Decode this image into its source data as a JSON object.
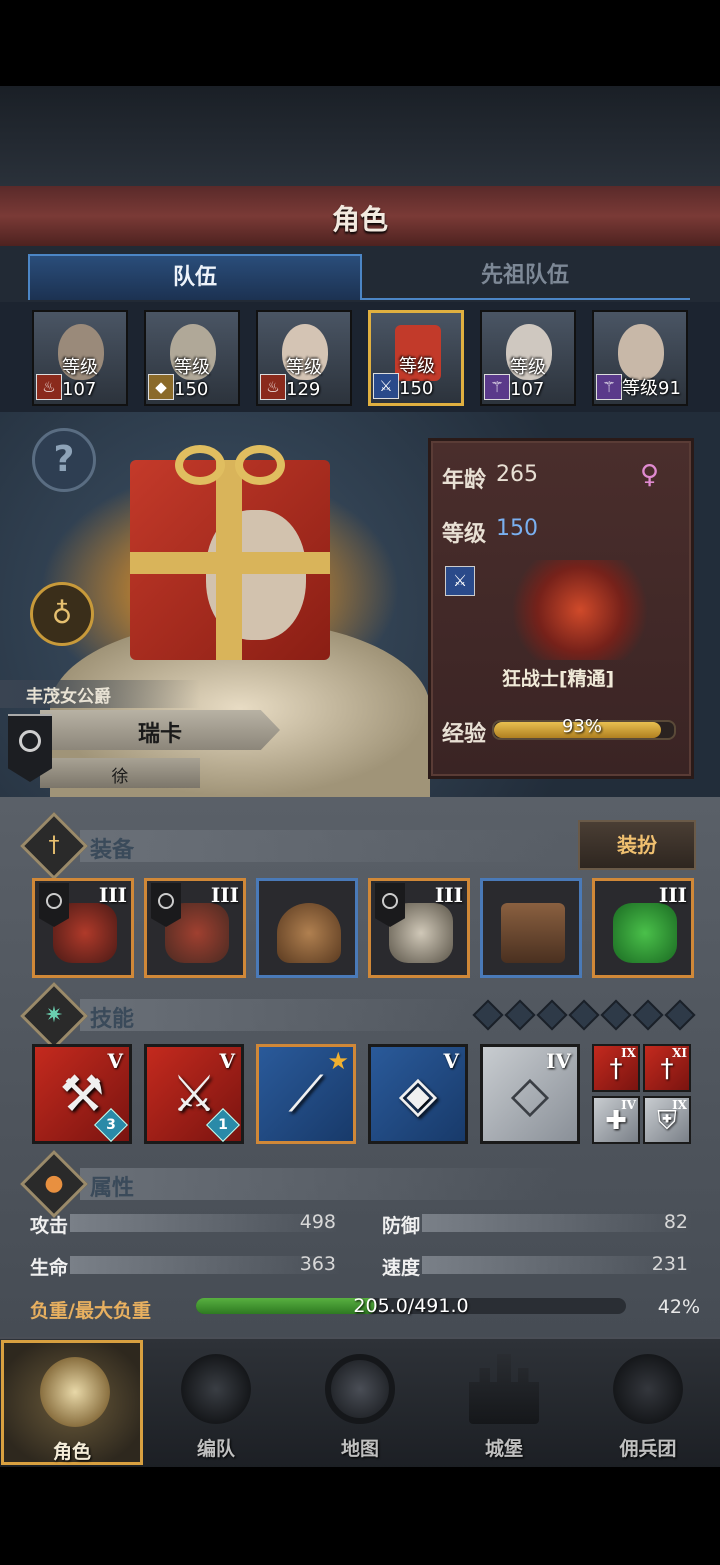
{
  "header": {
    "title": "角色"
  },
  "tabs": [
    {
      "label": "队伍",
      "active": true
    },
    {
      "label": "先祖队伍",
      "active": false
    }
  ],
  "roster": [
    {
      "level_text": "等级107",
      "class_icon": "fire-class-icon",
      "selected": false
    },
    {
      "level_text": "等级150",
      "class_icon": "shield-class-icon",
      "selected": false
    },
    {
      "level_text": "等级129",
      "class_icon": "fire-class-icon",
      "selected": false
    },
    {
      "level_text": "等级150",
      "class_icon": "sword-class-icon",
      "selected": true
    },
    {
      "level_text": "等级107",
      "class_icon": "staff-class-icon",
      "selected": false
    },
    {
      "level_text": "等级91",
      "class_icon": "staff-class-icon",
      "selected": false
    }
  ],
  "character": {
    "title": "丰茂女公爵",
    "name": "瑞卡",
    "subname": "徐"
  },
  "stats_card": {
    "age_label": "年龄",
    "age_value": "265",
    "level_label": "等级",
    "level_value": "150",
    "gender_icon": "female-icon",
    "class_name": "狂战士[精通]",
    "exp_label": "经验",
    "exp_text": "93%",
    "exp_fraction": 0.93
  },
  "equipment": {
    "section_title": "装备",
    "outfit_button": "装扮",
    "slots": [
      {
        "rank": "III",
        "frame": "orange",
        "flag": true,
        "icon": "weapon-icon"
      },
      {
        "rank": "III",
        "frame": "orange",
        "flag": true,
        "icon": "weapon-icon"
      },
      {
        "rank": "",
        "frame": "blue",
        "flag": false,
        "icon": "helmet-icon"
      },
      {
        "rank": "III",
        "frame": "orange",
        "flag": true,
        "icon": "armor-icon"
      },
      {
        "rank": "",
        "frame": "blue",
        "flag": false,
        "icon": "boots-icon"
      },
      {
        "rank": "III",
        "frame": "orange",
        "flag": false,
        "icon": "jade-trinket-icon"
      }
    ]
  },
  "skills": {
    "section_title": "技能",
    "slot_pips": 7,
    "list": [
      {
        "rank": "V",
        "color": "red",
        "count": "3",
        "icon": "axe-strike-icon"
      },
      {
        "rank": "V",
        "color": "red",
        "count": "1",
        "icon": "cleave-icon"
      },
      {
        "rank": "",
        "color": "blue",
        "count": "",
        "icon": "claw-slash-icon",
        "starred": true
      },
      {
        "rank": "V",
        "color": "blue",
        "count": "",
        "icon": "crystal-axe-icon"
      },
      {
        "rank": "IV",
        "color": "grey",
        "count": "",
        "icon": "crystal-shield-icon"
      }
    ],
    "passives": [
      {
        "rank": "IX",
        "color": "red",
        "icon": "sword-passive-icon"
      },
      {
        "rank": "XI",
        "color": "red",
        "icon": "sword-passive-icon"
      },
      {
        "rank": "IV",
        "color": "grey",
        "icon": "heal-cross-icon"
      },
      {
        "rank": "IX",
        "color": "grey",
        "icon": "shield-passive-icon"
      }
    ]
  },
  "attributes": {
    "section_title": "属性",
    "attack_label": "攻击",
    "attack_value": "498",
    "defense_label": "防御",
    "defense_value": "82",
    "hp_label": "生命",
    "hp_value": "363",
    "speed_label": "速度",
    "speed_value": "231",
    "load_label": "负重/最大负重",
    "load_text": "205.0/491.0",
    "load_percent": "42%",
    "load_fraction": 0.42
  },
  "nav": [
    {
      "label": "角色",
      "icon": "knight-icon",
      "selected": true
    },
    {
      "label": "编队",
      "icon": "helmet-squad-icon",
      "selected": false
    },
    {
      "label": "地图",
      "icon": "compass-map-icon",
      "selected": false
    },
    {
      "label": "城堡",
      "icon": "castle-icon",
      "selected": false
    },
    {
      "label": "佣兵团",
      "icon": "mercenary-icon",
      "selected": false
    }
  ]
}
